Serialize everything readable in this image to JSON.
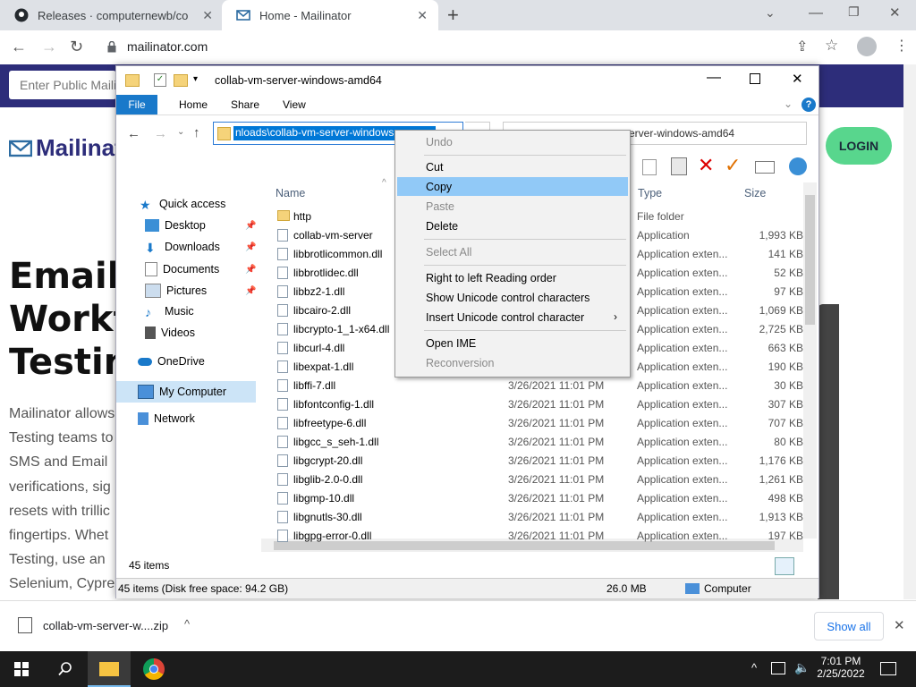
{
  "browser": {
    "tabs": [
      {
        "label": "Releases · computernewb/collab"
      },
      {
        "label": "Home - Mailinator"
      }
    ],
    "url": "mailinator.com"
  },
  "page": {
    "public_placeholder": "Enter Public Maili",
    "logo": "Mailinat",
    "login": "LOGIN",
    "hero": [
      "Emaili",
      "Workf",
      "Testin"
    ],
    "body": [
      "Mailinator allows",
      "Testing teams to",
      "SMS and Email",
      "verifications, sig",
      "resets with trillic",
      "fingertips. Whet",
      "Testing, use an",
      "Selenium, Cypre"
    ]
  },
  "explorer": {
    "title": "collab-vm-server-windows-amd64",
    "ribbon": {
      "file": "File",
      "home": "Home",
      "share": "Share",
      "view": "View"
    },
    "address_selected": "nloads\\collab-vm-server-windows",
    "search_text": "erver-windows-amd64",
    "nav": {
      "quick_access": "Quick access",
      "desktop": "Desktop",
      "downloads": "Downloads",
      "documents": "Documents",
      "pictures": "Pictures",
      "music": "Music",
      "videos": "Videos",
      "onedrive": "OneDrive",
      "mycomputer": "My Computer",
      "network": "Network"
    },
    "columns": {
      "name": "Name",
      "type": "Type",
      "size": "Size"
    },
    "rows": [
      {
        "name": "http",
        "date": "",
        "type": "File folder",
        "size": ""
      },
      {
        "name": "collab-vm-server",
        "date": "",
        "type": "Application",
        "size": "1,993 KB"
      },
      {
        "name": "libbrotlicommon.dll",
        "date": "",
        "type": "Application exten...",
        "size": "141 KB"
      },
      {
        "name": "libbrotlidec.dll",
        "date": "",
        "type": "Application exten...",
        "size": "52 KB"
      },
      {
        "name": "libbz2-1.dll",
        "date": "",
        "type": "Application exten...",
        "size": "97 KB"
      },
      {
        "name": "libcairo-2.dll",
        "date": "",
        "type": "Application exten...",
        "size": "1,069 KB"
      },
      {
        "name": "libcrypto-1_1-x64.dll",
        "date": "",
        "type": "Application exten...",
        "size": "2,725 KB"
      },
      {
        "name": "libcurl-4.dll",
        "date": "",
        "type": "Application exten...",
        "size": "663 KB"
      },
      {
        "name": "libexpat-1.dll",
        "date": "",
        "type": "Application exten...",
        "size": "190 KB"
      },
      {
        "name": "libffi-7.dll",
        "date": "3/26/2021 11:01 PM",
        "type": "Application exten...",
        "size": "30 KB"
      },
      {
        "name": "libfontconfig-1.dll",
        "date": "3/26/2021 11:01 PM",
        "type": "Application exten...",
        "size": "307 KB"
      },
      {
        "name": "libfreetype-6.dll",
        "date": "3/26/2021 11:01 PM",
        "type": "Application exten...",
        "size": "707 KB"
      },
      {
        "name": "libgcc_s_seh-1.dll",
        "date": "3/26/2021 11:01 PM",
        "type": "Application exten...",
        "size": "80 KB"
      },
      {
        "name": "libgcrypt-20.dll",
        "date": "3/26/2021 11:01 PM",
        "type": "Application exten...",
        "size": "1,176 KB"
      },
      {
        "name": "libglib-2.0-0.dll",
        "date": "3/26/2021 11:01 PM",
        "type": "Application exten...",
        "size": "1,261 KB"
      },
      {
        "name": "libgmp-10.dll",
        "date": "3/26/2021 11:01 PM",
        "type": "Application exten...",
        "size": "498 KB"
      },
      {
        "name": "libgnutls-30.dll",
        "date": "3/26/2021 11:01 PM",
        "type": "Application exten...",
        "size": "1,913 KB"
      },
      {
        "name": "libgpg-error-0.dll",
        "date": "3/26/2021 11:01 PM",
        "type": "Application exten...",
        "size": "197 KB"
      }
    ],
    "item_count": "45 items",
    "status_left": "45 items (Disk free space: 94.2 GB)",
    "status_size": "26.0 MB",
    "status_location": "Computer"
  },
  "context_menu": {
    "undo": "Undo",
    "cut": "Cut",
    "copy": "Copy",
    "paste": "Paste",
    "delete": "Delete",
    "select_all": "Select All",
    "rtl": "Right to left Reading order",
    "show_unicode": "Show Unicode control characters",
    "insert_unicode": "Insert Unicode control character",
    "open_ime": "Open IME",
    "reconversion": "Reconversion"
  },
  "downloads": {
    "file": "collab-vm-server-w....zip",
    "show_all": "Show all"
  },
  "taskbar": {
    "time": "7:01 PM",
    "date": "2/25/2022"
  },
  "colors": {
    "accent": "#0078d7",
    "mailinator_nav": "#2d2d7a",
    "login_green": "#58d68d",
    "menu_highlight": "#91c9f7"
  }
}
